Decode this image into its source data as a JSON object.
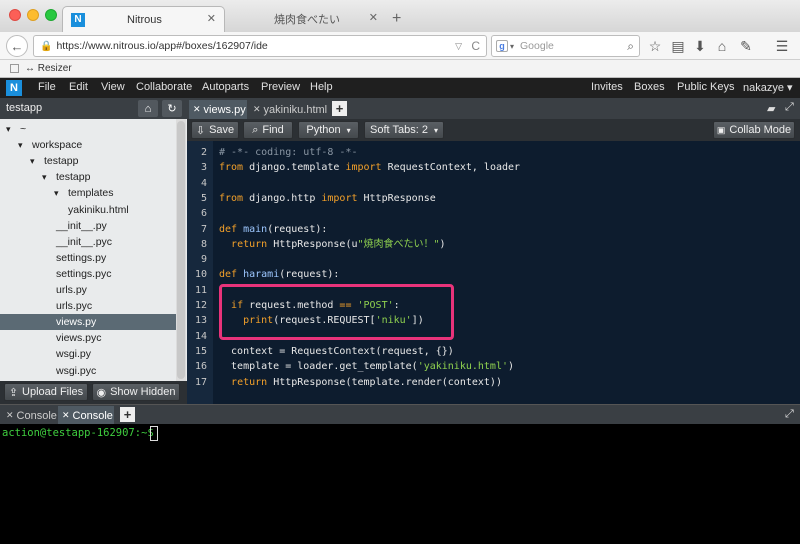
{
  "browser": {
    "tabs": [
      {
        "label": "Nitrous",
        "active": true
      },
      {
        "label": "焼肉食べたい",
        "active": false
      }
    ],
    "new_tab": "+",
    "url": "https://www.nitrous.io/app#/boxes/162907/ide",
    "search_placeholder": "Google",
    "bookmark": "↔ Resizer"
  },
  "app": {
    "logo": "N",
    "menu": [
      "File",
      "Edit",
      "View",
      "Collaborate",
      "Autoparts",
      "Preview",
      "Help"
    ],
    "right_menu": [
      "Invites",
      "Boxes",
      "Public Keys",
      "nakazye ▾"
    ]
  },
  "sidebar": {
    "project": "testapp",
    "tree": [
      {
        "label": "~",
        "indent": 0,
        "arrow": "▾"
      },
      {
        "label": "workspace",
        "indent": 1,
        "arrow": "▾"
      },
      {
        "label": "testapp",
        "indent": 2,
        "arrow": "▾"
      },
      {
        "label": "testapp",
        "indent": 3,
        "arrow": "▾"
      },
      {
        "label": "templates",
        "indent": 4,
        "arrow": "▾"
      },
      {
        "label": "yakiniku.html",
        "indent": 5,
        "arrow": ""
      },
      {
        "label": "__init__.py",
        "indent": 4,
        "arrow": ""
      },
      {
        "label": "__init__.pyc",
        "indent": 4,
        "arrow": ""
      },
      {
        "label": "settings.py",
        "indent": 4,
        "arrow": ""
      },
      {
        "label": "settings.pyc",
        "indent": 4,
        "arrow": ""
      },
      {
        "label": "urls.py",
        "indent": 4,
        "arrow": ""
      },
      {
        "label": "urls.pyc",
        "indent": 4,
        "arrow": ""
      },
      {
        "label": "views.py",
        "indent": 4,
        "arrow": "",
        "selected": true
      },
      {
        "label": "views.pyc",
        "indent": 4,
        "arrow": ""
      },
      {
        "label": "wsgi.py",
        "indent": 4,
        "arrow": ""
      },
      {
        "label": "wsgi.pyc",
        "indent": 4,
        "arrow": ""
      }
    ],
    "upload_label": "Upload Files",
    "show_hidden_label": "Show Hidden"
  },
  "editor": {
    "tabs": [
      {
        "label": "views.py",
        "active": true
      },
      {
        "label": "yakiniku.html",
        "active": false
      }
    ],
    "save_label": "Save",
    "find_label": "Find",
    "language": "Python",
    "tabs_setting": "Soft Tabs: 2",
    "collab_label": "Collab Mode",
    "lines": [
      {
        "n": "2",
        "html": "<span class=\"cm\"># -*- coding: utf-8 -*-</span>"
      },
      {
        "n": "3",
        "html": "<span class=\"kw\">from</span> django.template <span class=\"kw\">import</span> RequestContext, loader"
      },
      {
        "n": "4",
        "html": ""
      },
      {
        "n": "5",
        "html": "<span class=\"kw\">from</span> django.http <span class=\"kw\">import</span> HttpResponse"
      },
      {
        "n": "6",
        "html": ""
      },
      {
        "n": "7",
        "html": "<span class=\"kw\">def</span> <span class=\"fn\">main</span>(request):"
      },
      {
        "n": "8",
        "html": "  <span class=\"kw\">return</span> HttpResponse(u<span class=\"st\">\"焼肉食べたい！\"</span>)"
      },
      {
        "n": "9",
        "html": ""
      },
      {
        "n": "10",
        "html": "<span class=\"kw\">def</span> <span class=\"fn\">harami</span>(request):"
      },
      {
        "n": "11",
        "html": ""
      },
      {
        "n": "12",
        "html": "  <span class=\"kw\">if</span> request.method <span class=\"op\">==</span> <span class=\"st\">'POST'</span>:"
      },
      {
        "n": "13",
        "html": "    <span class=\"kw\">print</span>(request.REQUEST[<span class=\"st\">'niku'</span>])"
      },
      {
        "n": "14",
        "html": ""
      },
      {
        "n": "15",
        "html": "  context = RequestContext(request, {})"
      },
      {
        "n": "16",
        "html": "  template = loader.get_template(<span class=\"st\">'yakiniku.html'</span>)"
      },
      {
        "n": "17",
        "html": "  <span class=\"kw\">return</span> HttpResponse(template.render(context))"
      }
    ]
  },
  "console": {
    "tabs": [
      "Console",
      "Console"
    ],
    "prompt": "action@testapp-162907:~$"
  }
}
